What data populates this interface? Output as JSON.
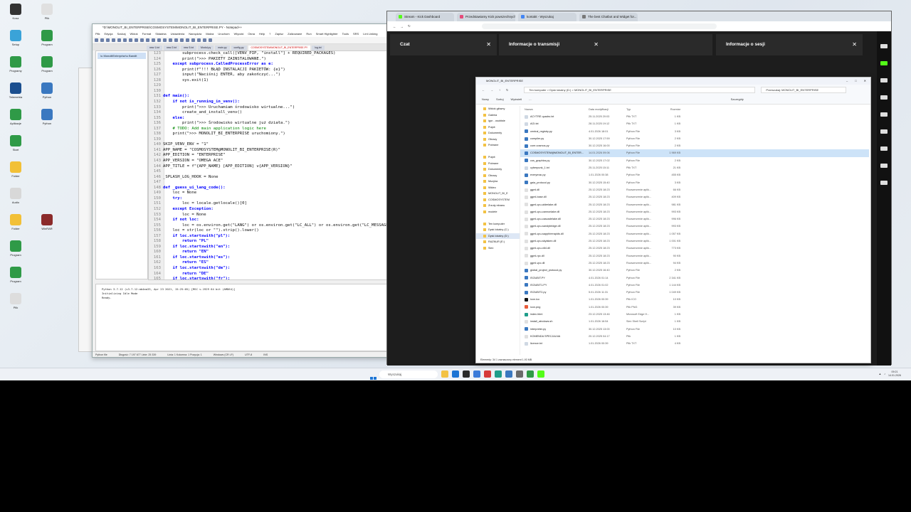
{
  "desktop": {
    "icons_col1": [
      {
        "label": "Kosz",
        "color": "#333"
      },
      {
        "label": "Setup",
        "color": "#3aa3d8"
      },
      {
        "label": "Programy",
        "color": "#2f9a47"
      },
      {
        "label": "Telemetria",
        "color": "#1b4f8f"
      },
      {
        "label": "Aplikacje",
        "color": "#2f9a47"
      },
      {
        "label": "Start",
        "color": "#2f9a47"
      },
      {
        "label": "Folder",
        "color": "#f2c037"
      },
      {
        "label": "Audio",
        "color": "#d8d8d8"
      },
      {
        "label": "Folder",
        "color": "#f2c037"
      },
      {
        "label": "Program",
        "color": "#2f9a47"
      },
      {
        "label": "Program",
        "color": "#2f9a47"
      },
      {
        "label": "Plik",
        "color": "#ddd"
      }
    ],
    "icons_col2": [
      {
        "label": "Plik",
        "color": "#e0e0e0"
      },
      {
        "label": "Program",
        "color": "#2f9a47"
      },
      {
        "label": "Program",
        "color": "#2f9a47"
      },
      {
        "label": "Python",
        "color": "#3a78c0"
      },
      {
        "label": "Python",
        "color": "#3a78c0"
      },
      {
        "label": "",
        "color": "transparent"
      },
      {
        "label": "",
        "color": "transparent"
      },
      {
        "label": "",
        "color": "transparent"
      },
      {
        "label": "WinRAR",
        "color": "#8b2a2a"
      }
    ]
  },
  "notepad": {
    "title": "*D:\\MONOLIT_BI_ENTERPRISE\\COSMOSYSTEM\\MONOLIT_BI_ENTERPRISE.PY - Notepad++",
    "menu": [
      "Plik",
      "Edycja",
      "Szukaj",
      "Widok",
      "Format",
      "Składnia",
      "Ustawienia",
      "Narzędzia",
      "Makra",
      "Uruchom",
      "Wtyczki",
      "Okna",
      "Help",
      "?",
      "Zapisz",
      "Zalizowane",
      "Run",
      "Smart Highlighter",
      "Tools",
      "SRS",
      "Lint Linking"
    ],
    "tabs": [
      {
        "label": "new 1.txt",
        "active": false
      },
      {
        "label": "new 2.txt",
        "active": false
      },
      {
        "label": "new 3.txt",
        "active": false
      },
      {
        "label": "Modul.py",
        "active": false
      },
      {
        "label": "main.py",
        "active": false
      },
      {
        "label": "config.py",
        "active": false
      },
      {
        "label": "COSMOSYSTEM\\MONOLIT_BI_ENTERPRISE.PY",
        "active": true
      },
      {
        "label": "log.txt",
        "active": false
      }
    ],
    "doclist_item": "\\u MonolitEnterprise\\u Bandit",
    "code_lines": [
      {
        "n": "123",
        "text": "        subprocess.check_call([VENV_PIP, \"install\"] + REQUIRED_PACKAGES)"
      },
      {
        "n": "124",
        "text": "        print(\">>> PAKIETY ZAINSTALOWANE.\")"
      },
      {
        "n": "125",
        "text": "    except subprocess.CalledProcessError as e:"
      },
      {
        "n": "126",
        "text": "        print(f\"!!! BŁĄD INSTALACJI PAKIETÓW: {e}\")"
      },
      {
        "n": "127",
        "text": "        input(\"Naciśnij ENTER, aby zakończyć...\")"
      },
      {
        "n": "128",
        "text": "        sys.exit(1)"
      },
      {
        "n": "129",
        "text": ""
      },
      {
        "n": "130",
        "text": ""
      },
      {
        "n": "131",
        "text": "def main():"
      },
      {
        "n": "132",
        "text": "    if not is_running_in_venv():"
      },
      {
        "n": "133",
        "text": "        print(\">>> Uruchamiam środowisko wirtualne...\")"
      },
      {
        "n": "134",
        "text": "        create_and_install_venv()"
      },
      {
        "n": "135",
        "text": "    else:"
      },
      {
        "n": "136",
        "text": "        print(\">>> Środowisko wirtualne już działa.\")"
      },
      {
        "n": "137",
        "text": "    # TODO: Add main application logic here"
      },
      {
        "n": "138",
        "text": "    print(\">>> MONOLIT_BI_ENTERPRISE uruchomiony.\")"
      },
      {
        "n": "139",
        "text": ""
      },
      {
        "n": "140",
        "text": "SKIP_VENV_ENV = \"1\""
      },
      {
        "n": "141",
        "text": "APP_NAME = \"COSMOSYSTEM@MONOLIT_BI_ENTERPRISE(R)\""
      },
      {
        "n": "142",
        "text": "APP_EDITION = \"ENTERPRISE\""
      },
      {
        "n": "143",
        "text": "APP_VERSION = \"OMEGA ACE\""
      },
      {
        "n": "144",
        "text": "APP_TITLE = f\"{APP_NAME} [APP_EDITION] v{APP_VERSION}\""
      },
      {
        "n": "145",
        "text": ""
      },
      {
        "n": "146",
        "text": "_SPLASH_LOG_HOOK = None"
      },
      {
        "n": "147",
        "text": ""
      },
      {
        "n": "148",
        "text": "def _guess_ui_lang_code():"
      },
      {
        "n": "149",
        "text": "    loc = None"
      },
      {
        "n": "150",
        "text": "    try:"
      },
      {
        "n": "151",
        "text": "        loc = locale.getlocale()[0]"
      },
      {
        "n": "152",
        "text": "    except Exception:"
      },
      {
        "n": "153",
        "text": "        loc = None"
      },
      {
        "n": "154",
        "text": "    if not loc:"
      },
      {
        "n": "155",
        "text": "        loc = os.environ.get(\"LANG\") or os.environ.get(\"LC_ALL\") or os.environ.get(\"LC_MESSAGES\")"
      },
      {
        "n": "156",
        "text": "    loc = str(loc or \"\").strip().lower()"
      },
      {
        "n": "157",
        "text": "    if loc.startswith(\"pl\"):"
      },
      {
        "n": "158",
        "text": "        return \"PL\""
      },
      {
        "n": "159",
        "text": "    if loc.startswith(\"en\"):"
      },
      {
        "n": "160",
        "text": "        return \"EN\""
      },
      {
        "n": "161",
        "text": "    if loc.startswith(\"es\"):"
      },
      {
        "n": "162",
        "text": "        return \"ES\""
      },
      {
        "n": "163",
        "text": "    if loc.startswith(\"de\"):"
      },
      {
        "n": "164",
        "text": "        return \"DE\""
      },
      {
        "n": "165",
        "text": "    if loc.startswith(\"fr\"):"
      }
    ],
    "console_lines": [
      "Python 3.7.12 (v3.7.12:ab4aa33, Apr 23 2021, 15:25:05) [MSC v.1929 64 bit (AMD64)]",
      "Initializing Idle Mode",
      "Ready."
    ],
    "status": {
      "type": "Python file",
      "length": "Długość: 7 197 677    Linie: 25 339",
      "pos": "Linia: 1    Kolumna: 1    Pozycja: 1",
      "eol": "Windows (CR LF)",
      "enc": "UTF-8",
      "mode": "INS"
    }
  },
  "chrome": {
    "tabs": [
      {
        "label": "Stream - Kick Dashboard",
        "color": "#53fc18",
        "active": false
      },
      {
        "label": "Przedstawiamy Kick powszechnych",
        "color": "#e54b7a",
        "active": false
      },
      {
        "label": "kontakt - Wyszukaj",
        "color": "#4285f4",
        "active": false
      },
      {
        "label": "The best Chatbot and Widget for...",
        "color": "#777",
        "active": false
      }
    ],
    "panels": [
      {
        "label": "Czat"
      },
      {
        "label": "Informacje o transmisji"
      },
      {
        "label": "Informacje o sesji"
      }
    ]
  },
  "explorer": {
    "title": "MONOLIT_BI_ENTERPRISE",
    "breadcrumb": "Ten komputer  >  Dysk lokalny (D:)  >  MONOLIT_BI_ENTERPRISE",
    "search_placeholder": "Przeszukaj: MONOLIT_BI_ENTERPRISE",
    "commands": [
      "Nowy",
      "Sortuj",
      "Wyświetl",
      "...",
      "Szczegóły"
    ],
    "nav": [
      {
        "label": "Widok główny",
        "sel": false
      },
      {
        "label": "Galeria",
        "sel": false
      },
      {
        "label": "igor - osobiste",
        "sel": false
      },
      {
        "label": "Pulpit",
        "sel": false
      },
      {
        "label": "Dokumenty",
        "sel": false
      },
      {
        "label": "Obrazy",
        "sel": false
      },
      {
        "label": "Pobrane",
        "sel": false
      },
      {
        "label": "",
        "sel": false
      },
      {
        "label": "Pulpit",
        "sel": false
      },
      {
        "label": "Pobrane",
        "sel": false
      },
      {
        "label": "Dokumenty",
        "sel": false
      },
      {
        "label": "Obrazy",
        "sel": false
      },
      {
        "label": "Muzyka",
        "sel": false
      },
      {
        "label": "Wideo",
        "sel": false
      },
      {
        "label": "MONOLIT_BI_E",
        "sel": false
      },
      {
        "label": "COSMOSYSTEM",
        "sel": false
      },
      {
        "label": "Zrzuty ekranu",
        "sel": false
      },
      {
        "label": "modele",
        "sel": false
      },
      {
        "label": "",
        "sel": false
      },
      {
        "label": "Ten komputer",
        "sel": false
      },
      {
        "label": "Dysk lokalny (C:)",
        "sel": false
      },
      {
        "label": "Dysk lokalny (D:)",
        "sel": true
      },
      {
        "label": "RAZNUR (E:)",
        "sel": false
      },
      {
        "label": "Sieć",
        "sel": false
      }
    ],
    "columns": [
      "Nazwa",
      "Data modyfikacji",
      "Typ",
      "Rozmiar"
    ],
    "files": [
      {
        "name": "ACYTRE quadro.txt",
        "date": "25.11.2025 20:03",
        "type": "Plik TXT",
        "size": "1 KB",
        "color": "#cfd8e3",
        "sel": false
      },
      {
        "name": "AGI.txt",
        "date": "28.11.2025 19:12",
        "type": "Plik TXT",
        "size": "1 KB",
        "color": "#cfd8e3",
        "sel": false
      },
      {
        "name": "central_registry.py",
        "date": "4.01.2026 18:01",
        "type": "Python File",
        "size": "3 KB",
        "color": "#3a78c0",
        "sel": false
      },
      {
        "name": "compiler.py",
        "date": "30.12.2025 17:59",
        "type": "Python File",
        "size": "2 KB",
        "color": "#3a78c0",
        "sel": false
      },
      {
        "name": "core.cosmos.py",
        "date": "30.12.2025 16:00",
        "type": "Python File",
        "size": "2 KB",
        "color": "#3a78c0",
        "sel": false
      },
      {
        "name": "COSMOSYSTEM@MONOLIT_BI_ENTER...",
        "date": "14.01.2026 09:06",
        "type": "Python File",
        "size": "1 969 KB",
        "color": "#3a78c0",
        "sel": true
      },
      {
        "name": "cos_graphics.py",
        "date": "30.12.2025 17:02",
        "type": "Python File",
        "size": "2 KB",
        "color": "#3a78c0",
        "sel": false
      },
      {
        "name": "cyberpunk_1.txt",
        "date": "25.11.2025 15:11",
        "type": "Plik TXT",
        "size": "21 KB",
        "color": "#cfd8e3",
        "sel": false
      },
      {
        "name": "everymac.py",
        "date": "1.01.2026 00:38",
        "type": "Python File",
        "size": "455 KB",
        "color": "#3a78c0",
        "sel": false
      },
      {
        "name": "gaia_protocol.py",
        "date": "30.12.2025 15:40",
        "type": "Python File",
        "size": "3 KB",
        "color": "#3a78c0",
        "sel": false
      },
      {
        "name": "ggml.dll",
        "date": "25.12.2025 18:23",
        "type": "Rozszerzenie aplik...",
        "size": "66 KB",
        "color": "#e0e0e0",
        "sel": false
      },
      {
        "name": "ggml-base.dll",
        "date": "25.12.2025 18:23",
        "type": "Rozszerzenie aplik...",
        "size": "409 KB",
        "color": "#e0e0e0",
        "sel": false
      },
      {
        "name": "ggml-cpu-alderlake.dll",
        "date": "25.12.2025 18:23",
        "type": "Rozszerzenie aplik...",
        "size": "981 KB",
        "color": "#e0e0e0",
        "sel": false
      },
      {
        "name": "ggml-cpu-cannonlake.dll",
        "date": "25.12.2025 18:23",
        "type": "Rozszerzenie aplik...",
        "size": "993 KB",
        "color": "#e0e0e0",
        "sel": false
      },
      {
        "name": "ggml-cpu-cascadelake.dll",
        "date": "25.12.2025 18:23",
        "type": "Rozszerzenie aplik...",
        "size": "996 KB",
        "color": "#e0e0e0",
        "sel": false
      },
      {
        "name": "ggml-cpu-sandybridge.dll",
        "date": "25.12.2025 18:23",
        "type": "Rozszerzenie aplik...",
        "size": "993 KB",
        "color": "#e0e0e0",
        "sel": false
      },
      {
        "name": "ggml-cpu-sapphirerapids.dll",
        "date": "25.12.2025 18:23",
        "type": "Rozszerzenie aplik...",
        "size": "1 057 KB",
        "color": "#e0e0e0",
        "sel": false
      },
      {
        "name": "ggml-cpu-skylakex.dll",
        "date": "25.12.2025 18:23",
        "type": "Rozszerzenie aplik...",
        "size": "1 001 KB",
        "color": "#e0e0e0",
        "sel": false
      },
      {
        "name": "ggml-cpu-x64.dll",
        "date": "25.12.2025 18:23",
        "type": "Rozszerzenie aplik...",
        "size": "773 KB",
        "color": "#e0e0e0",
        "sel": false
      },
      {
        "name": "ggml-rpc.dll",
        "date": "25.12.2025 18:23",
        "type": "Rozszerzenie aplik...",
        "size": "90 KB",
        "color": "#e0e0e0",
        "sel": false
      },
      {
        "name": "ggml-vpc.dll",
        "date": "25.12.2025 18:23",
        "type": "Rozszerzenie aplik...",
        "size": "94 KB",
        "color": "#e0e0e0",
        "sel": false
      },
      {
        "name": "global_project_protocol.py",
        "date": "30.12.2025 16:40",
        "type": "Python File",
        "size": "2 KB",
        "color": "#3a78c0",
        "sel": false
      },
      {
        "name": "ISOUBIT.PY",
        "date": "4.01.2026 01:14",
        "type": "Python File",
        "size": "2 341 KB",
        "color": "#3a78c0",
        "sel": false
      },
      {
        "name": "ISOUBIT1.PY",
        "date": "4.01.2026 01:02",
        "type": "Python File",
        "size": "1 144 KB",
        "color": "#3a78c0",
        "sel": false
      },
      {
        "name": "ISOUBIT2.py",
        "date": "5.01.2026 11:31",
        "type": "Python File",
        "size": "1 049 KB",
        "color": "#3a78c0",
        "sel": false
      },
      {
        "name": "icon.ico",
        "date": "1.01.2026 00:39",
        "type": "Plik ICO",
        "size": "10 KB",
        "color": "#111",
        "sel": false
      },
      {
        "name": "icon.png",
        "date": "1.01.2026 00:39",
        "type": "Plik PNG",
        "size": "39 KB",
        "color": "#e85c3a",
        "sel": false
      },
      {
        "name": "index.html",
        "date": "23.12.2025 13:46",
        "type": "Microsoft Edge H...",
        "size": "1 KB",
        "color": "#1f9d8a",
        "sel": false
      },
      {
        "name": "install_windows.sh",
        "date": "1.01.2026 16:54",
        "type": "Sieć Shell Script",
        "size": "1 KB",
        "color": "#e0e0e0",
        "sel": false
      },
      {
        "name": "interpreter.py",
        "date": "30.12.2025 13:00",
        "type": "Python File",
        "size": "10 KB",
        "color": "#3a78c0",
        "sel": false
      },
      {
        "name": "KOMENDA SPECJALNA",
        "date": "20.12.2025 04:17",
        "type": "Plik",
        "size": "1 KB",
        "color": "#e0e0e0",
        "sel": false
      },
      {
        "name": "licence.txt",
        "date": "1.01.2026 00:39",
        "type": "Plik TXT",
        "size": "4 KB",
        "color": "#cfd8e3",
        "sel": false
      }
    ],
    "status": "Elementy: 34    1 zaznaczony element   1,93 MB"
  },
  "taskbar": {
    "search_placeholder": "Wyszukaj",
    "apps": [
      "#f3c244",
      "#1c74d4",
      "#2a2a2a",
      "#3b7bd9",
      "#d63a3a",
      "#1f9d8a",
      "#3a78c0",
      "#6a6a6a",
      "#2f9a47",
      "#53fc18"
    ],
    "time": "09:21",
    "date": "14.01.2026"
  }
}
